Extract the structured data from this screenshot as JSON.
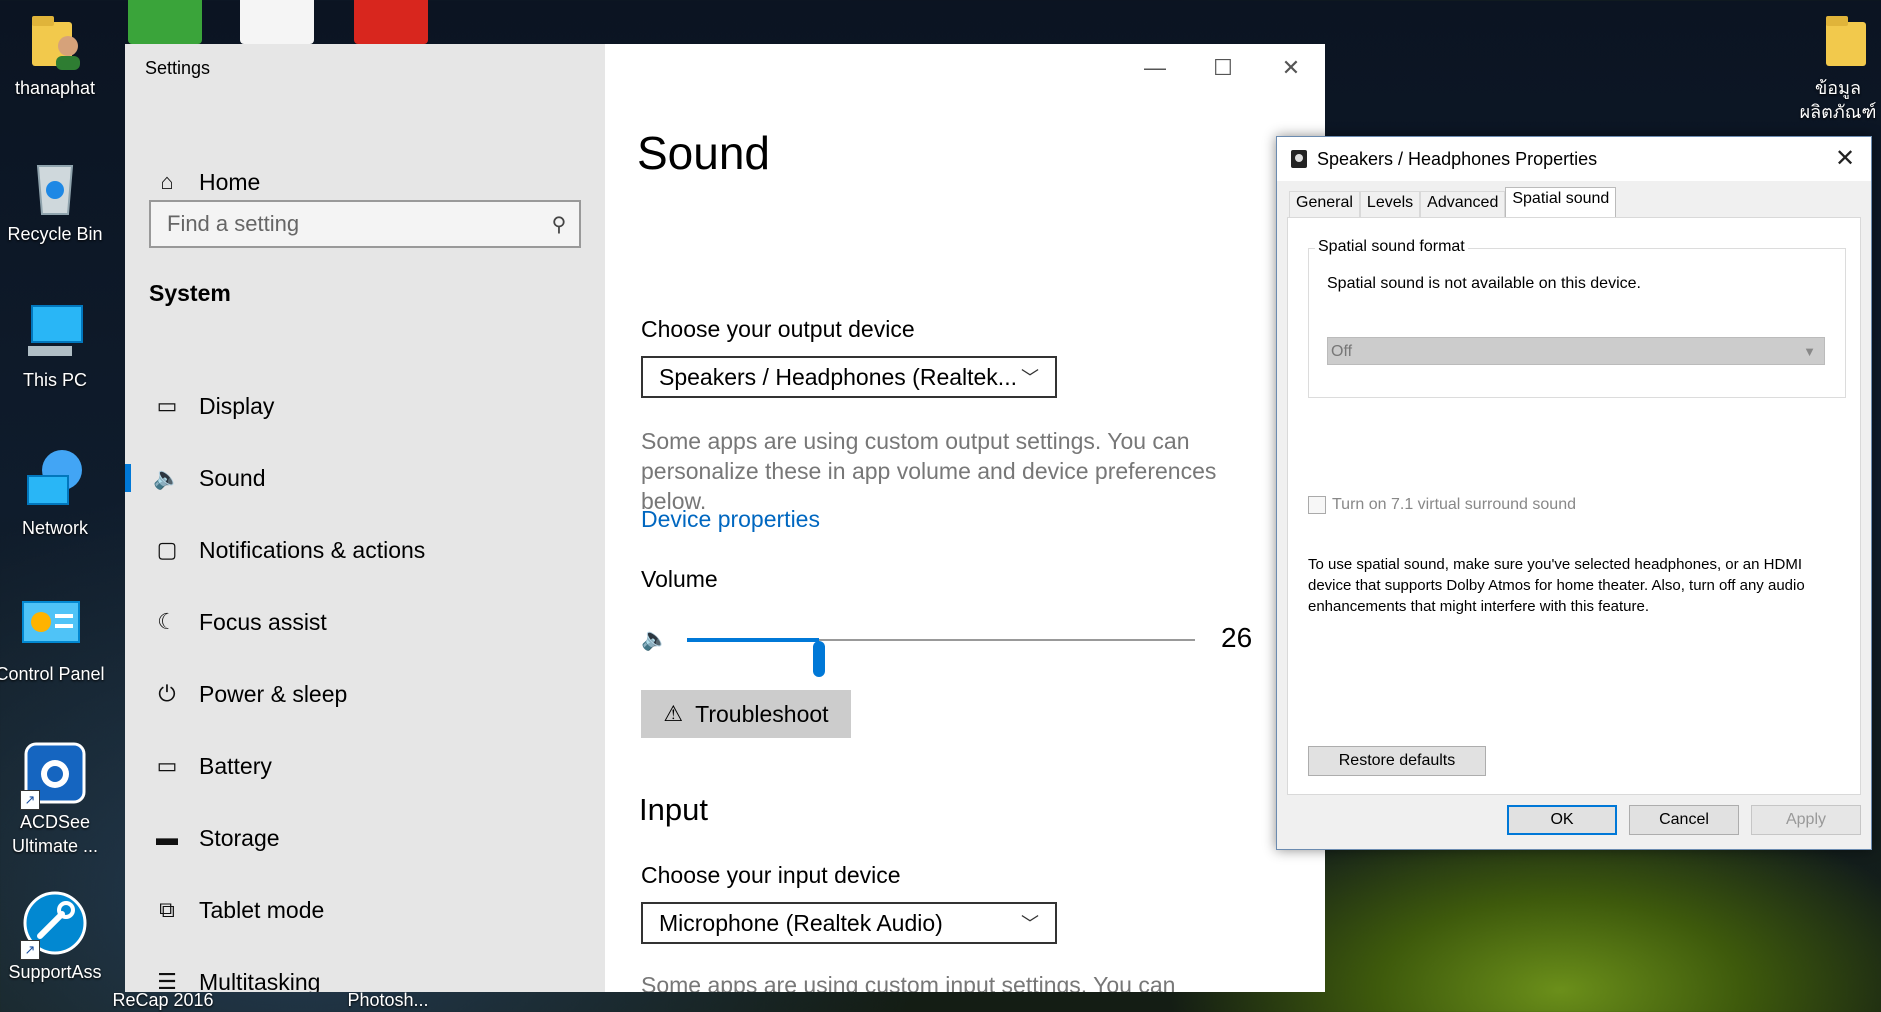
{
  "desktop": {
    "icons": [
      {
        "label": "thanaphat"
      },
      {
        "label": "Recycle Bin"
      },
      {
        "label": "This PC"
      },
      {
        "label": "Network"
      },
      {
        "label": "Control Panel"
      },
      {
        "label": "ACDSee Ultimate ..."
      },
      {
        "label": "SupportAss"
      }
    ],
    "right_icon": {
      "label": "ข้อมูล ผลิตภัณฑ์"
    },
    "bottom_labels": [
      "ReCap 2016",
      "Photosh..."
    ]
  },
  "settings": {
    "app_title": "Settings",
    "home_label": "Home",
    "search_placeholder": "Find a setting",
    "group_label": "System",
    "nav_items": [
      {
        "label": "Display",
        "icon": "display-icon"
      },
      {
        "label": "Sound",
        "icon": "speaker-icon",
        "active": true
      },
      {
        "label": "Notifications & actions",
        "icon": "notification-icon"
      },
      {
        "label": "Focus assist",
        "icon": "moon-icon"
      },
      {
        "label": "Power & sleep",
        "icon": "power-icon"
      },
      {
        "label": "Battery",
        "icon": "battery-icon"
      },
      {
        "label": "Storage",
        "icon": "storage-icon"
      },
      {
        "label": "Tablet mode",
        "icon": "tablet-icon"
      },
      {
        "label": "Multitasking",
        "icon": "multitasking-icon"
      }
    ],
    "page": {
      "heading": "Sound",
      "output_label": "Choose your output device",
      "output_device": "Speakers / Headphones (Realtek...",
      "output_hint": "Some apps are using custom output settings. You can personalize these in app volume and device preferences below.",
      "device_properties_link": "Device properties",
      "volume_label": "Volume",
      "volume_value": "26",
      "volume_level": 0.26,
      "troubleshoot_label": "Troubleshoot",
      "input_heading": "Input",
      "input_label": "Choose your input device",
      "input_device": "Microphone (Realtek Audio)",
      "input_hint": "Some apps are using custom input settings. You can personalize these in app volume and device preferences below."
    }
  },
  "dialog": {
    "title": "Speakers / Headphones Properties",
    "tabs": [
      "General",
      "Levels",
      "Advanced",
      "Spatial sound"
    ],
    "selected_tab": "Spatial sound",
    "group_label": "Spatial sound format",
    "not_available_text": "Spatial sound is not available on this device.",
    "format_value": "Off",
    "checkbox_label": "Turn on 7.1 virtual surround sound",
    "info_text": "To use spatial sound, make sure you've selected headphones, or an HDMI device that supports Dolby Atmos for home theater. Also, turn off any audio enhancements that might interfere with this feature.",
    "restore_label": "Restore defaults",
    "ok_label": "OK",
    "cancel_label": "Cancel",
    "apply_label": "Apply"
  },
  "colors": {
    "accent": "#0078d7",
    "link": "#0067c0"
  }
}
